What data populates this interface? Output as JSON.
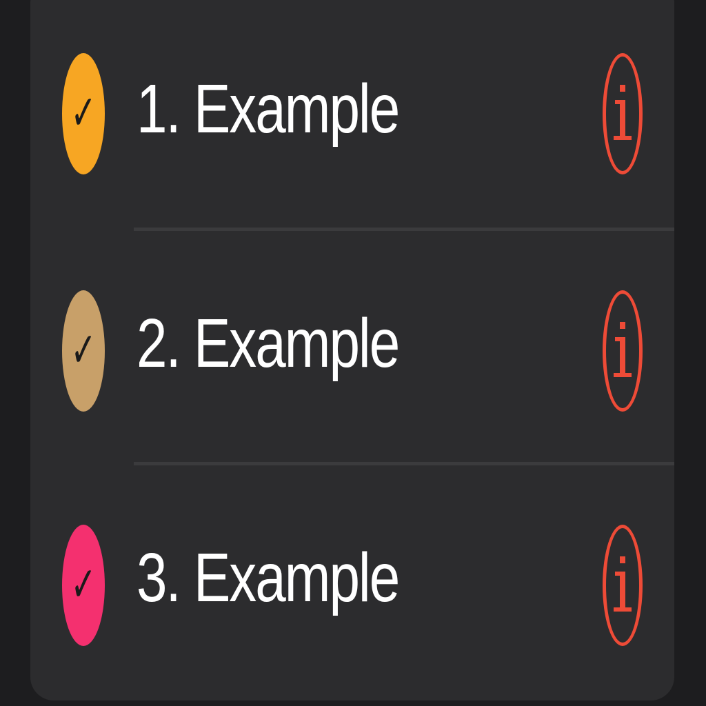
{
  "list": {
    "items": [
      {
        "label": "1. Example",
        "check_color": "#f7a623",
        "checked": true,
        "check_glyph": "✓"
      },
      {
        "label": "2. Example",
        "check_color": "#c8a069",
        "checked": true,
        "check_glyph": "✓"
      },
      {
        "label": "3. Example",
        "check_color": "#f4306f",
        "checked": true,
        "check_glyph": "✓"
      }
    ],
    "info_icon_color": "#ee4b37",
    "info_icon": "info-icon",
    "check_icon": "checkmark-icon"
  }
}
